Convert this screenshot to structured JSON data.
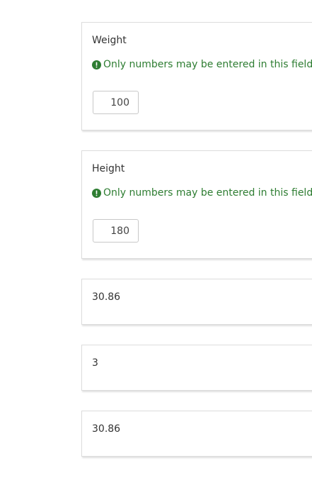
{
  "weight": {
    "label": "Weight",
    "hint": "Only numbers may be entered in this field.",
    "value": "100"
  },
  "height": {
    "label": "Height",
    "hint": "Only numbers may be entered in this field.",
    "value": "180"
  },
  "results": [
    "30.86",
    "3",
    "30.86"
  ],
  "colors": {
    "hint": "#2e7d32",
    "border": "#dcdcdc"
  },
  "icons": {
    "hint": "exclamation-circle-icon"
  }
}
